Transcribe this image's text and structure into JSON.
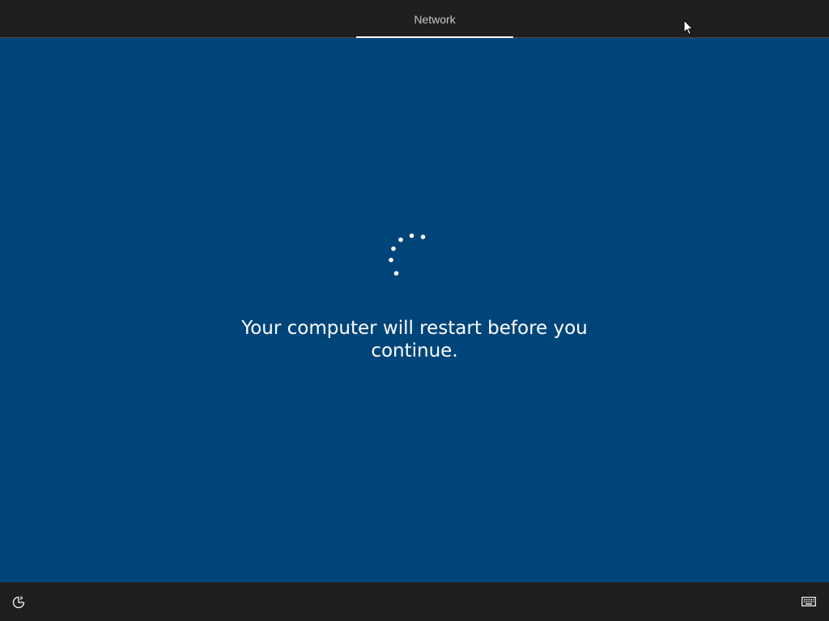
{
  "header": {
    "tabs": [
      {
        "label": "Network",
        "active": true
      }
    ]
  },
  "main": {
    "loading": true,
    "message": "Your computer will restart before you continue."
  },
  "footer": {
    "left_icon": "ease-of-access-icon",
    "right_icon": "keyboard-icon"
  },
  "colors": {
    "background": "#00457a",
    "bars": "#1f1f1f",
    "text": "#ffffff",
    "tab_text": "#c9c9c9"
  }
}
